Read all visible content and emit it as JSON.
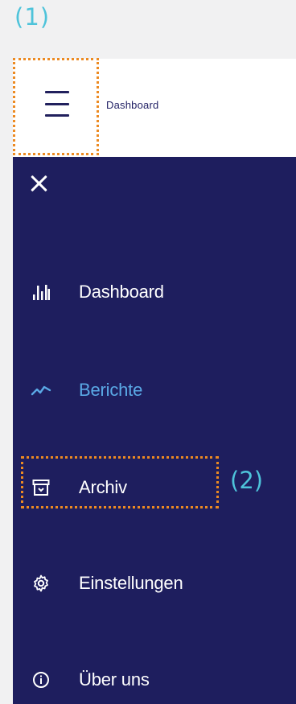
{
  "annotations": {
    "callout_1": "(1)",
    "callout_2": "(2)"
  },
  "topbar": {
    "title": "Dashboard",
    "menu_icon": "hamburger-icon"
  },
  "drawer": {
    "close_icon": "close-icon",
    "items": [
      {
        "label": "Dashboard",
        "icon": "bar-chart-icon",
        "active": false
      },
      {
        "label": "Berichte",
        "icon": "trend-line-icon",
        "active": true
      },
      {
        "label": "Archiv",
        "icon": "archive-icon",
        "active": false
      },
      {
        "label": "Einstellungen",
        "icon": "gear-icon",
        "active": false
      },
      {
        "label": "Über uns",
        "icon": "info-icon",
        "active": false
      }
    ]
  },
  "colors": {
    "drawer_bg": "#1e1e5e",
    "active_text": "#5aa9e6",
    "highlight_border": "#ec8a22",
    "callout_text": "#4ec3da"
  }
}
